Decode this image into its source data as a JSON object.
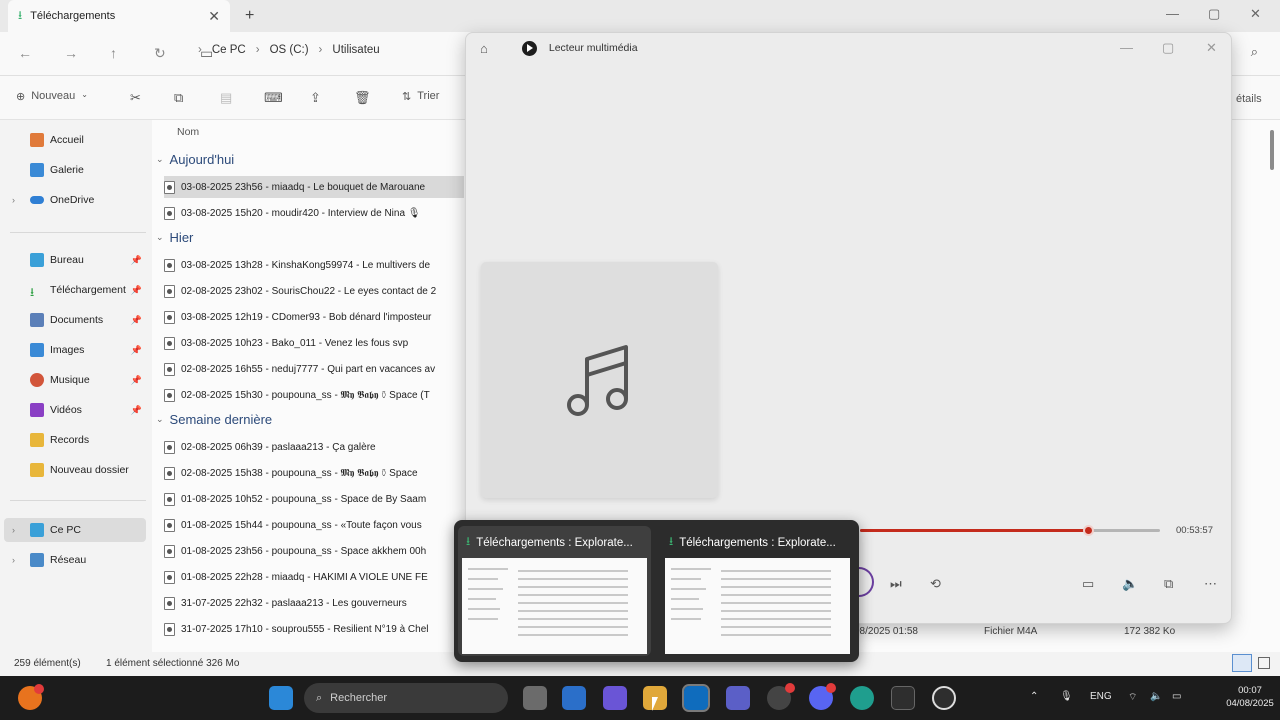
{
  "explorer": {
    "tab_title": "Téléchargements",
    "breadcrumb": [
      "Ce PC",
      "OS (C:)",
      "Utilisateu"
    ],
    "toolbar": {
      "new_label": "Nouveau",
      "sort_label": "Trier",
      "details_label": "étails"
    },
    "sidebar": [
      {
        "label": "Accueil",
        "pinned": false
      },
      {
        "label": "Galerie",
        "pinned": false
      },
      {
        "label": "OneDrive",
        "pinned": false
      },
      {
        "label": "Bureau",
        "pinned": true
      },
      {
        "label": "Téléchargement",
        "pinned": true
      },
      {
        "label": "Documents",
        "pinned": true
      },
      {
        "label": "Images",
        "pinned": true
      },
      {
        "label": "Musique",
        "pinned": true
      },
      {
        "label": "Vidéos",
        "pinned": true
      },
      {
        "label": "Records",
        "pinned": false
      },
      {
        "label": "Nouveau dossier",
        "pinned": false
      },
      {
        "label": "Ce PC",
        "pinned": false
      },
      {
        "label": "Réseau",
        "pinned": false
      }
    ],
    "column_name": "Nom",
    "groups": [
      {
        "label": "Aujourd'hui",
        "files": [
          "03-08-2025 23h56 - miaadq - Le bouquet de Marouane",
          "03-08-2025 15h20 - moudir420 - Interview de Nina 🎙"
        ]
      },
      {
        "label": "Hier",
        "files": [
          "03-08-2025 13h28 - KinshaKong59974 - Le multivers de",
          "02-08-2025 23h02 - SourisChou22 - Le eyes contact de 2",
          "03-08-2025 12h19 - CDomer93 - Bob dénard l'imposteur",
          "03-08-2025 10h23 - Bako_011 - Venez les fous svp",
          "02-08-2025 16h55 - neduj7777 - Qui part en vacances av",
          "02-08-2025 15h30 - poupouna_ss - 𝕸𝖞 𝕭𝖆𝖇𝖞 ⚱ Space (T"
        ]
      },
      {
        "label": "Semaine dernière",
        "files": [
          "02-08-2025 06h39 - paslaaa213 - Ça galère",
          "02-08-2025 15h38 - poupouna_ss - 𝕸𝖞 𝕭𝖆𝖇𝖞 ⚱ Space",
          "01-08-2025 10h52 - poupouna_ss - Space de By Saam",
          "01-08-2025 15h44 - poupouna_ss - «Toute façon vous",
          "01-08-2025 23h56 - poupouna_ss - Space akkhem 00h",
          "01-08-2025 22h28 - miaadq - HAKIMI A VIOLE UNE FE",
          "31-07-2025 22h32 - paslaaa213 - Les gouverneurs",
          "31-07-2025 17h10 - souprou555 - Resilient N°19 à Chel"
        ]
      }
    ],
    "selected_file_meta": {
      "date": "08/2025 01:58",
      "type": "Fichier M4A",
      "size": "172 382 Ko"
    },
    "status": {
      "count": "259 élément(s)",
      "selection": "1 élément sélectionné  326 Mo"
    }
  },
  "player": {
    "title": "Lecteur multimédia",
    "time": "00:53:57",
    "progress": 0.76
  },
  "thumbnails": [
    {
      "label": "Téléchargements : Explorate..."
    },
    {
      "label": "Téléchargements : Explorate..."
    }
  ],
  "taskbar": {
    "search_placeholder": "Rechercher",
    "lang": "ENG",
    "time": "00:07",
    "date": "04/08/2025"
  }
}
